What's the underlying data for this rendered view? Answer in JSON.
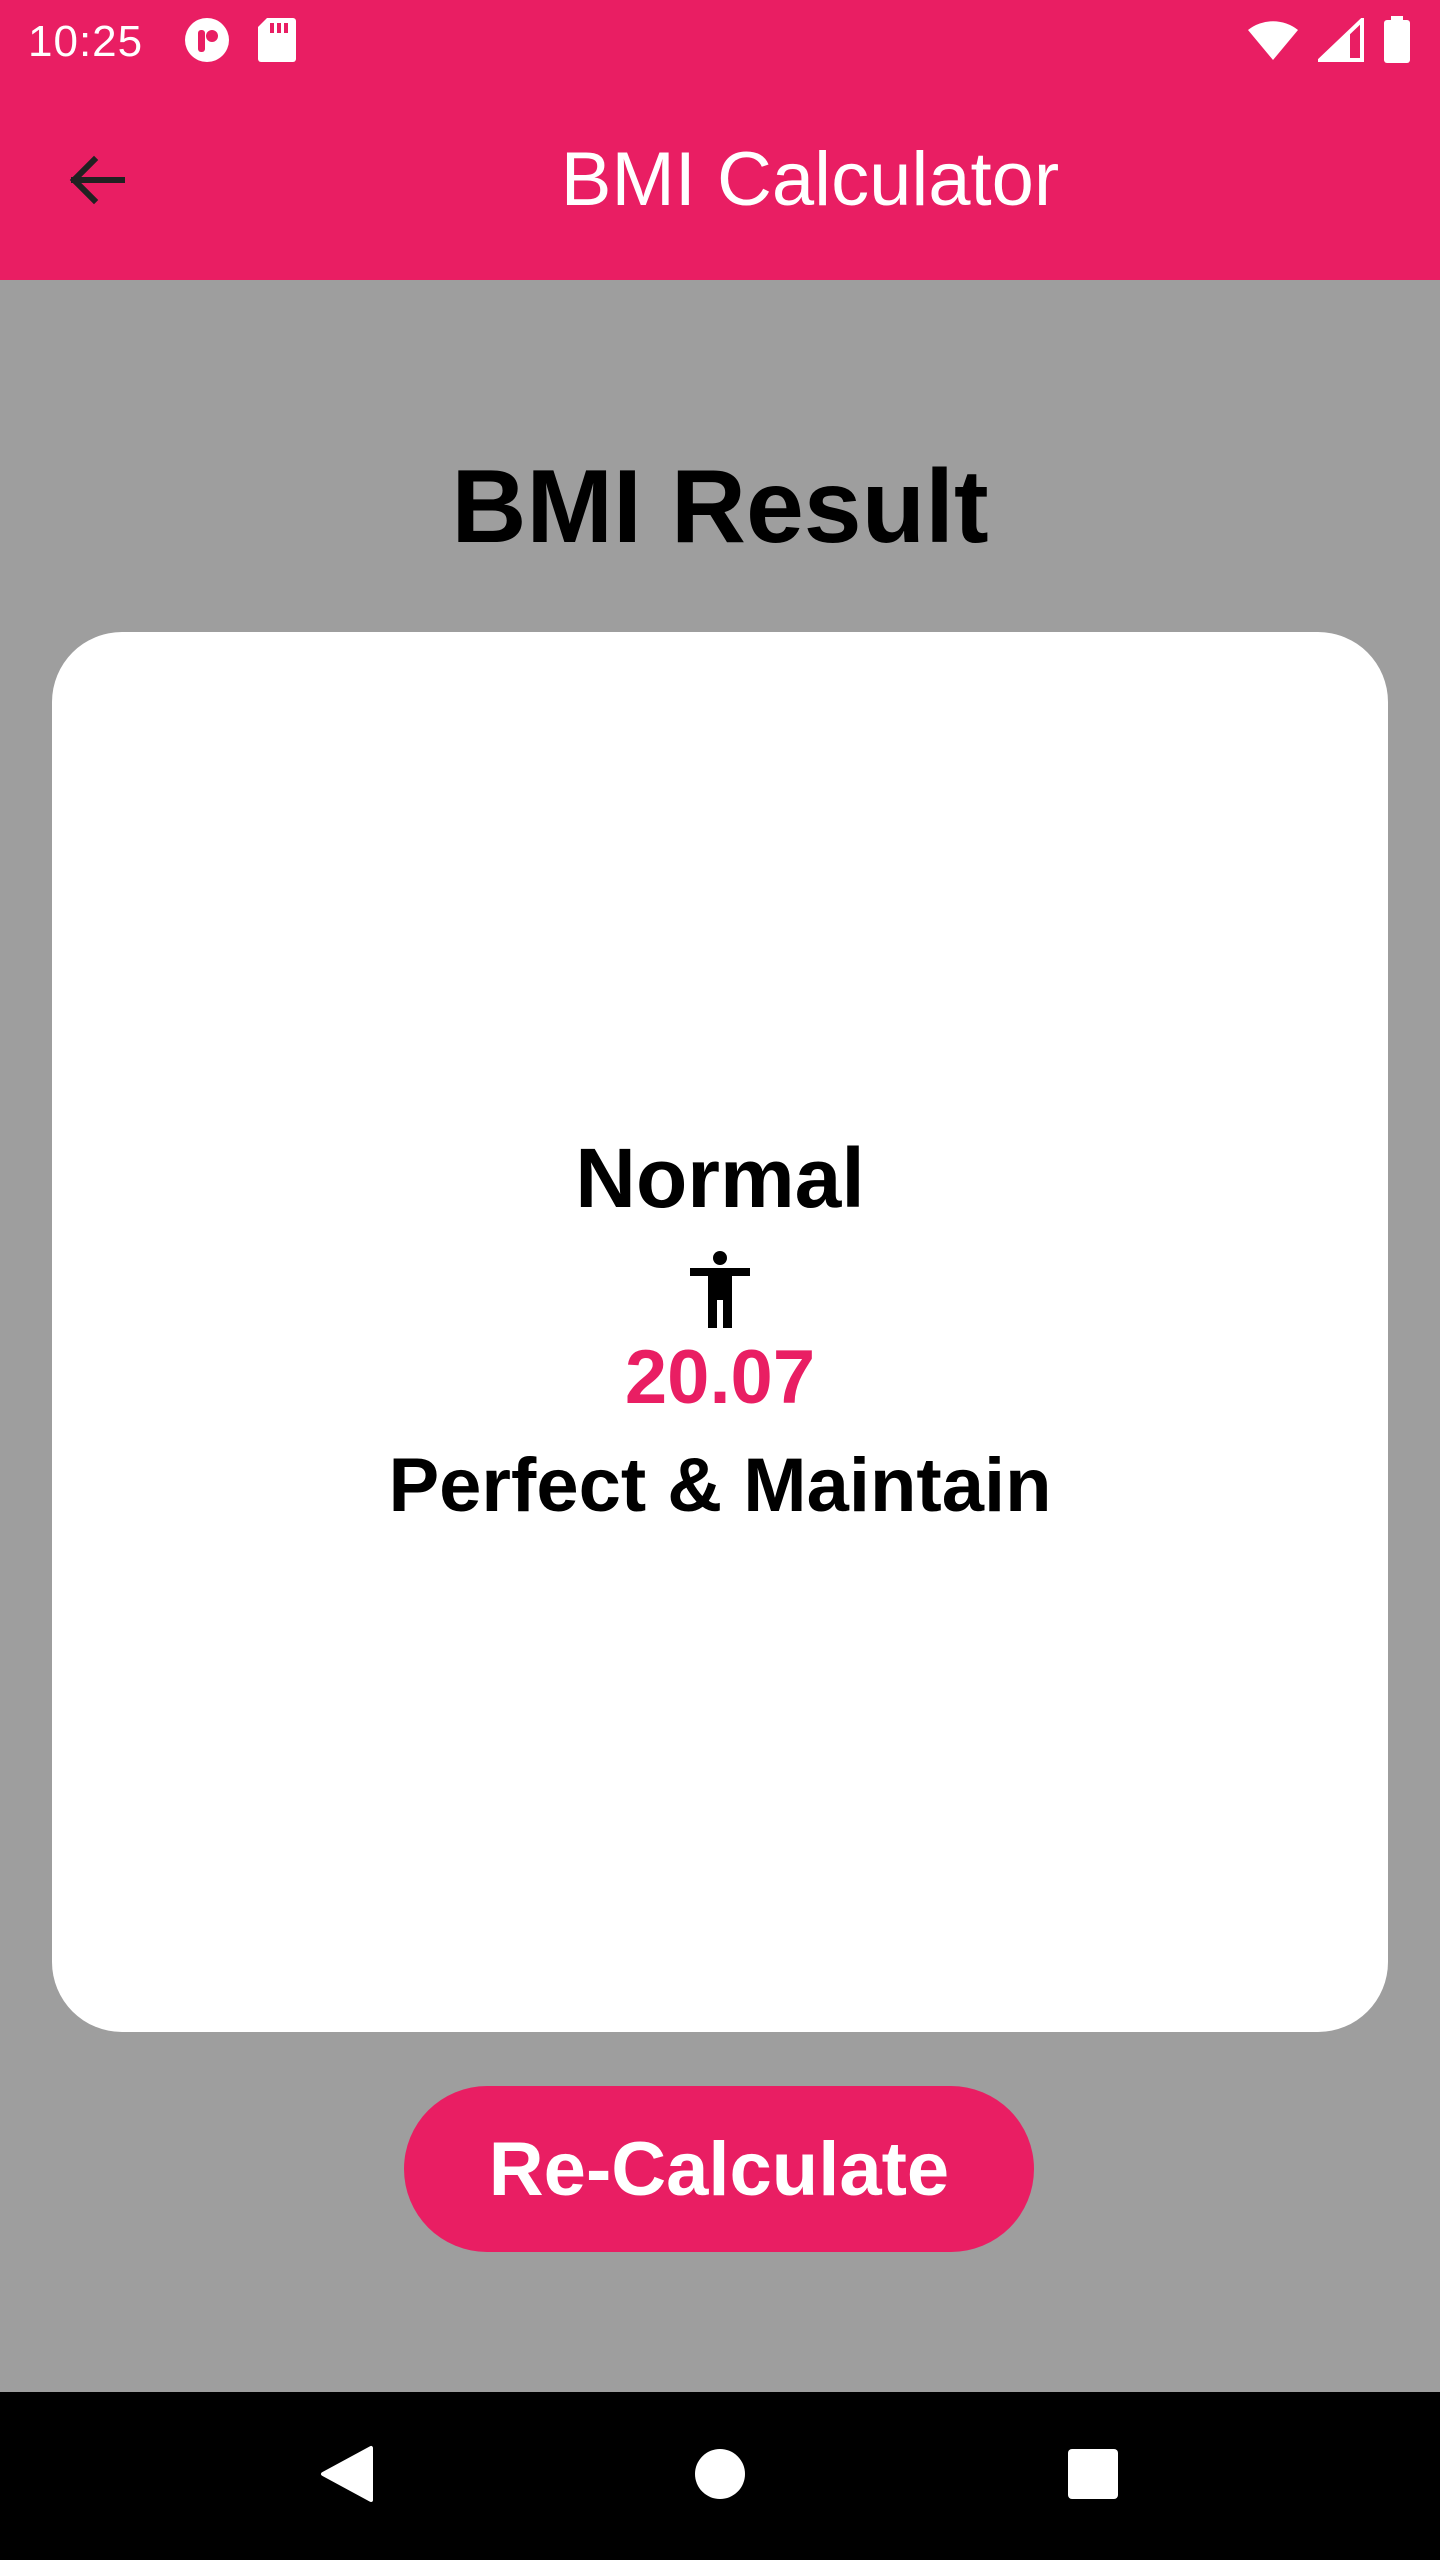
{
  "status_bar": {
    "time": "10:25",
    "icons_left": [
      "app-notification-icon",
      "sd-card-icon"
    ],
    "icons_right": [
      "wifi-icon",
      "cell-signal-icon",
      "battery-icon"
    ]
  },
  "app_bar": {
    "title": "BMI Calculator",
    "back_icon": "arrow-back-icon"
  },
  "main": {
    "heading": "BMI Result",
    "card": {
      "category": "Normal",
      "icon": "accessibility-person-icon",
      "bmi_value": "20.07",
      "advice": "Perfect & Maintain"
    },
    "recalculate_label": "Re-Calculate"
  },
  "nav_bar": {
    "buttons": [
      "back-triangle-icon",
      "home-circle-icon",
      "recents-square-icon"
    ]
  },
  "colors": {
    "accent": "#e91e63",
    "background": "#9e9e9e",
    "card": "#ffffff",
    "nav": "#000000"
  }
}
